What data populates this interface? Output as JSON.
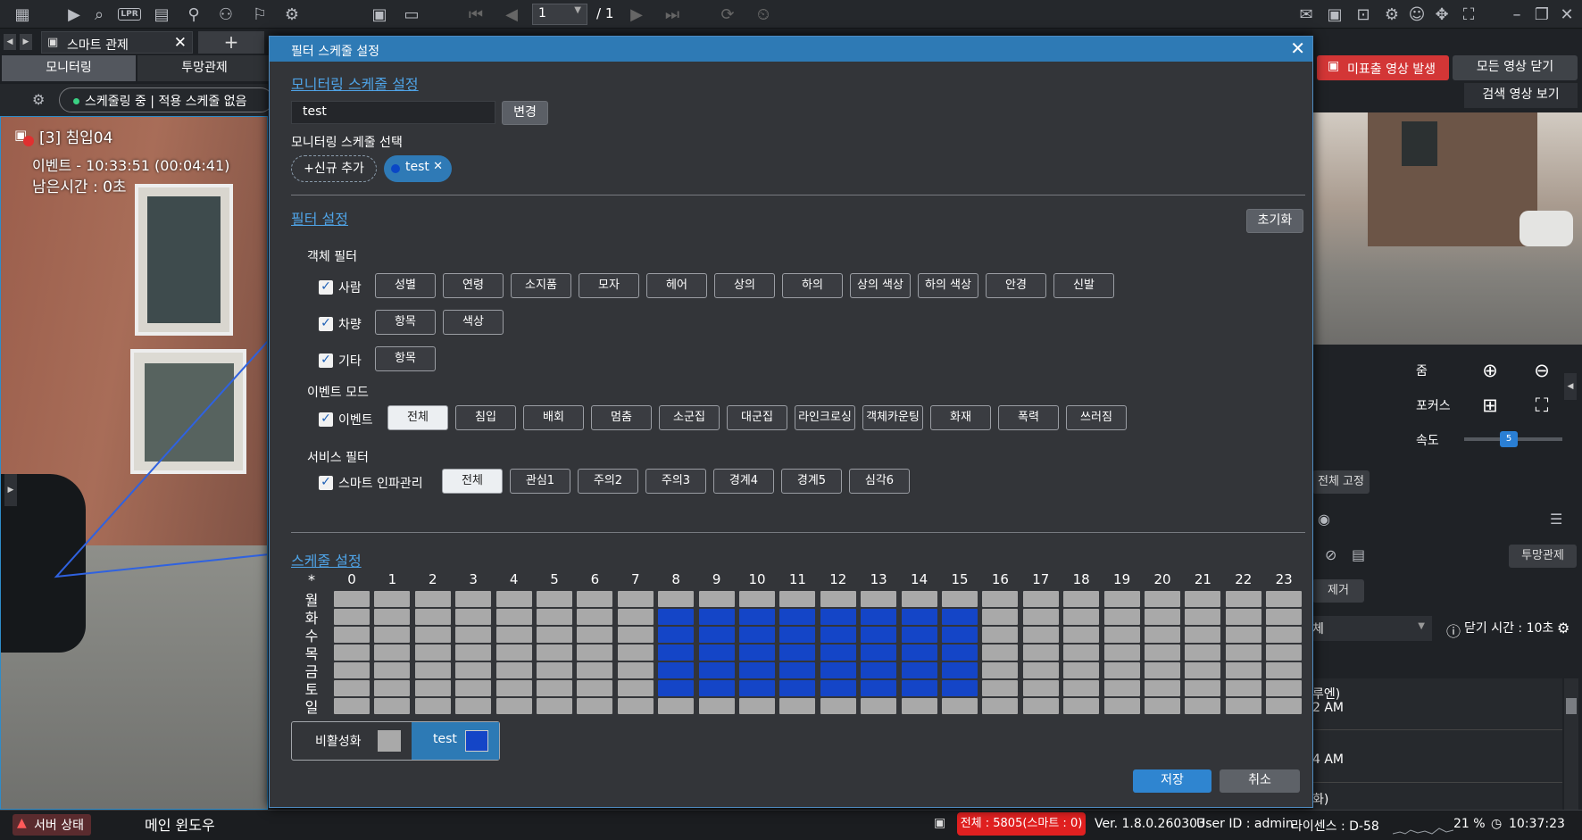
{
  "app": {
    "tab_label": "스마트 관제",
    "mode_tabs": [
      "모니터링",
      "투망관제"
    ],
    "schedule_status": "스케줄링 중 | 적용 스케줄 없음",
    "toolbar": {
      "page_current": "1",
      "page_total": "/ 1",
      "lpr": "LPR"
    }
  },
  "left_camera": {
    "label": "[3] 침입04",
    "event": "이벤트 - 10:33:51 (00:04:41)",
    "remaining": "남은시간 : 0초"
  },
  "right_panel": {
    "alert_button": "미표출 영상 발생",
    "close_all": "모든 영상 닫기",
    "search_view": "검색 영상 보기",
    "zoom": "줌",
    "focus": "포커스",
    "speed": "속도",
    "speed_value": "5",
    "fix_all": "전체 고정",
    "tumang": "투망관제",
    "remove": "제거",
    "select_value": "체",
    "close_time": "닫기 시간 : 10초",
    "list_items": [
      "루엔)",
      "2 AM",
      "4 AM",
      "화)"
    ]
  },
  "dialog": {
    "title": "필터 스케줄 설정",
    "monitoring_section": "모니터링 스케줄 설정",
    "name_value": "test",
    "change_button": "변경",
    "select_label": "모니터링 스케줄 선택",
    "add_new": "+신규 추가",
    "chip_label": "test",
    "filter_section": "필터 설정",
    "reset_button": "초기화",
    "object_filter_label": "객체 필터",
    "rows": {
      "person": {
        "label": "사람",
        "options": [
          "성별",
          "연령",
          "소지품",
          "모자",
          "헤어",
          "상의",
          "하의",
          "상의 색상",
          "하의 색상",
          "안경",
          "신발"
        ]
      },
      "vehicle": {
        "label": "차량",
        "options": [
          "항목",
          "색상"
        ]
      },
      "other": {
        "label": "기타",
        "options": [
          "항목"
        ]
      }
    },
    "event_mode_label": "이벤트 모드",
    "event": {
      "label": "이벤트",
      "options": [
        "전체",
        "침입",
        "배회",
        "멈춤",
        "소군집",
        "대군집",
        "라인크로싱",
        "객체카운팅",
        "화재",
        "폭력",
        "쓰러짐"
      ],
      "selected": 0
    },
    "service_filter_label": "서비스 필터",
    "service": {
      "label": "스마트 인파관리",
      "options": [
        "전체",
        "관심1",
        "주의2",
        "주의3",
        "경계4",
        "경계5",
        "심각6"
      ],
      "selected": 0
    },
    "schedule_section": "스케줄 설정",
    "grid": {
      "corner": "*",
      "hours": [
        "0",
        "1",
        "2",
        "3",
        "4",
        "5",
        "6",
        "7",
        "8",
        "9",
        "10",
        "11",
        "12",
        "13",
        "14",
        "15",
        "16",
        "17",
        "18",
        "19",
        "20",
        "21",
        "22",
        "23"
      ],
      "days": [
        "월",
        "화",
        "수",
        "목",
        "금",
        "토",
        "일"
      ],
      "active_days": [
        1,
        2,
        3,
        4,
        5
      ],
      "active_hours": [
        8,
        9,
        10,
        11,
        12,
        13,
        14,
        15
      ]
    },
    "legend": {
      "disabled": "비활성화",
      "test": "test"
    },
    "save": "저장",
    "cancel": "취소"
  },
  "status_bar": {
    "server_status": "서버 상태",
    "main_window": "메인 윈도우",
    "total": "전체 : 5805(스마트 : 0)",
    "version": "Ver. 1.8.0.260303",
    "user": "User ID : admin",
    "license": "라이센스 : D-58",
    "cpu": "21 %",
    "time": "10:37:23"
  },
  "colors": {
    "accent": "#2e7ab5",
    "active_cell": "#1445c7",
    "inactive_cell": "#a9a9a9",
    "alert": "#d33636"
  }
}
